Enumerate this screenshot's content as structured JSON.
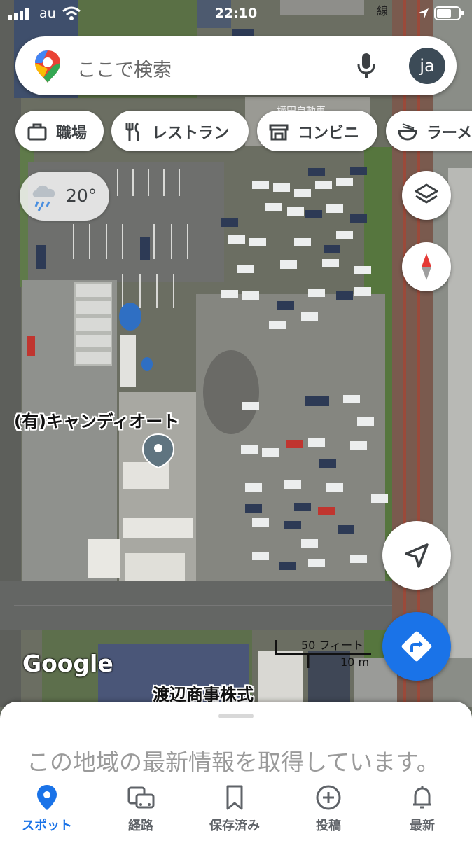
{
  "status_bar": {
    "carrier": "au",
    "time": "22:10"
  },
  "search": {
    "placeholder": "ここで検索",
    "avatar_initials": "ja"
  },
  "chips": [
    {
      "icon": "briefcase-icon",
      "label": "職場"
    },
    {
      "icon": "restaurant-icon",
      "label": "レストラン"
    },
    {
      "icon": "convenience-store-icon",
      "label": "コンビニ"
    },
    {
      "icon": "ramen-icon",
      "label": "ラーメン"
    }
  ],
  "weather": {
    "icon": "rain-cloud-icon",
    "temperature": "20°"
  },
  "map": {
    "place_label": "(有)キャンディオート",
    "building_label": "渡辺商事株式",
    "sign_label": "横田自動車",
    "rail_label": "線",
    "scale_feet": "50 フィート",
    "scale_meters": "10 m",
    "attribution": "Google",
    "colors": {
      "pin": "#5f7480",
      "accent_blue": "#1a73e8",
      "compass_red": "#e53935"
    }
  },
  "controls": {
    "layers": "layers-icon",
    "compass": "compass-icon",
    "my_location": "navigation-arrow-icon",
    "directions": "directions-icon"
  },
  "sheet": {
    "message": "この地域の最新情報を取得しています。"
  },
  "nav": [
    {
      "icon": "location-pin-icon",
      "label": "スポット",
      "active": true
    },
    {
      "icon": "commute-icon",
      "label": "経路",
      "active": false
    },
    {
      "icon": "bookmark-icon",
      "label": "保存済み",
      "active": false
    },
    {
      "icon": "add-circle-icon",
      "label": "投稿",
      "active": false
    },
    {
      "icon": "bell-icon",
      "label": "最新",
      "active": false
    }
  ]
}
